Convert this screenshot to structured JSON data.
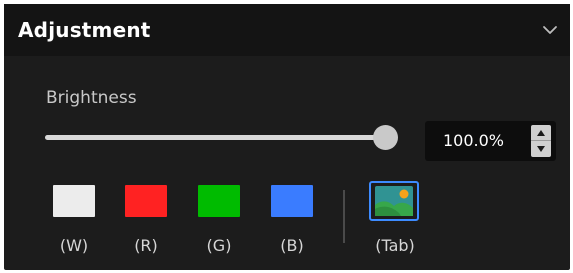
{
  "panel": {
    "title": "Adjustment",
    "collapse_icon": "chevron-down-icon"
  },
  "brightness": {
    "label": "Brightness",
    "value": 100.0,
    "value_text": "100.0%",
    "min": 0,
    "max": 100
  },
  "channels": [
    {
      "key": "W",
      "label": "(W)",
      "color": "#ececec"
    },
    {
      "key": "R",
      "label": "(R)",
      "color": "#ff2222"
    },
    {
      "key": "G",
      "label": "(G)",
      "color": "#00bb00"
    },
    {
      "key": "B",
      "label": "(B)",
      "color": "#3a7cff"
    }
  ],
  "tab_button": {
    "label": "(Tab)",
    "icon": "image-icon",
    "accent": "#3d8bff"
  },
  "colors": {
    "panel_bg": "#1c1c1c",
    "header_bg": "#141414",
    "accent": "#3d8bff"
  }
}
